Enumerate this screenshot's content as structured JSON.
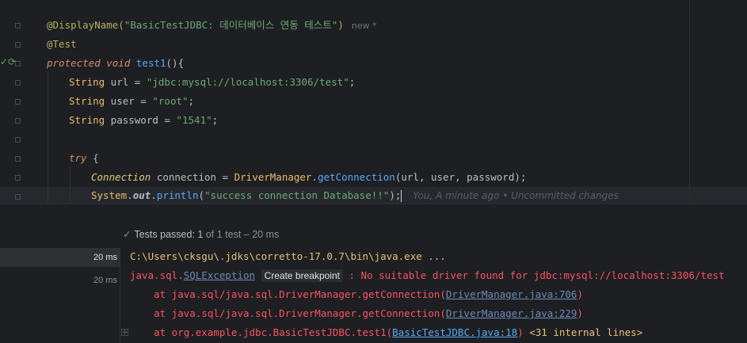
{
  "editor": {
    "line1_annotation": "@DisplayName(",
    "line1_string": "\"BasicTestJDBC: 데이터베이스 연동 테스트\"",
    "line1_close": ")",
    "line1_hint": "new *",
    "line2": "@Test",
    "line3_kw": "protected void",
    "line3_name": "test1",
    "line3_rest": "(){",
    "line4_type": "String",
    "line4_var": " url = ",
    "line4_str": "\"jdbc:mysql://localhost:3306/test\"",
    "line4_end": ";",
    "line5_type": "String",
    "line5_var": " user = ",
    "line5_str": "\"root\"",
    "line5_end": ";",
    "line6_type": "String",
    "line6_var": " password = ",
    "line6_str": "\"1541\"",
    "line6_end": ";",
    "line7_kw": "try",
    "line7_rest": " {",
    "line8_type": "Connection",
    "line8_var": " connection = ",
    "line8_cls": "DriverManager",
    "line8_dot": ".",
    "line8_fn": "getConnection",
    "line8_args": "(url, user, password);",
    "line9_sys": "System",
    "line9_dot1": ".",
    "line9_out": "out",
    "line9_dot2": ".",
    "line9_fn": "println",
    "line9_open": "(",
    "line9_str": "\"success connection Database!!\"",
    "line9_close": ");",
    "line9_blame": "You, A minute ago • Uncommitted changes"
  },
  "run": {
    "status_label": "Tests passed:",
    "status_count": "1",
    "status_detail": "of 1 test – 20 ms",
    "left_rows": [
      "20 ms",
      "20 ms"
    ],
    "out1": "C:\\Users\\cksgu\\.jdks\\corretto-17.0.7\\bin\\java.exe ...",
    "out2_prefix": "java.sql.",
    "out2_link": "SQLException",
    "out2_crumb": "Create breakpoint",
    "out2_msg": " : No suitable driver found for jdbc:mysql://localhost:3306/test",
    "out3_prefix": "    at java.sql/java.sql.DriverManager.getConnection(",
    "out3_link": "DriverManager.java:706",
    "out3_end": ")",
    "out4_prefix": "    at java.sql/java.sql.DriverManager.getConnection(",
    "out4_link": "DriverManager.java:229",
    "out4_end": ")",
    "out5_prefix": "    at org.example.jdbc.BasicTestJDBC.test1(",
    "out5_link": "BasicTestJDBC.java:18",
    "out5_end": ")",
    "out5_internal": " <31 internal lines>"
  },
  "colors": {
    "background": "#1e1f22",
    "error": "#f75464",
    "pass": "#59a869",
    "link": "#6b8bb8"
  }
}
